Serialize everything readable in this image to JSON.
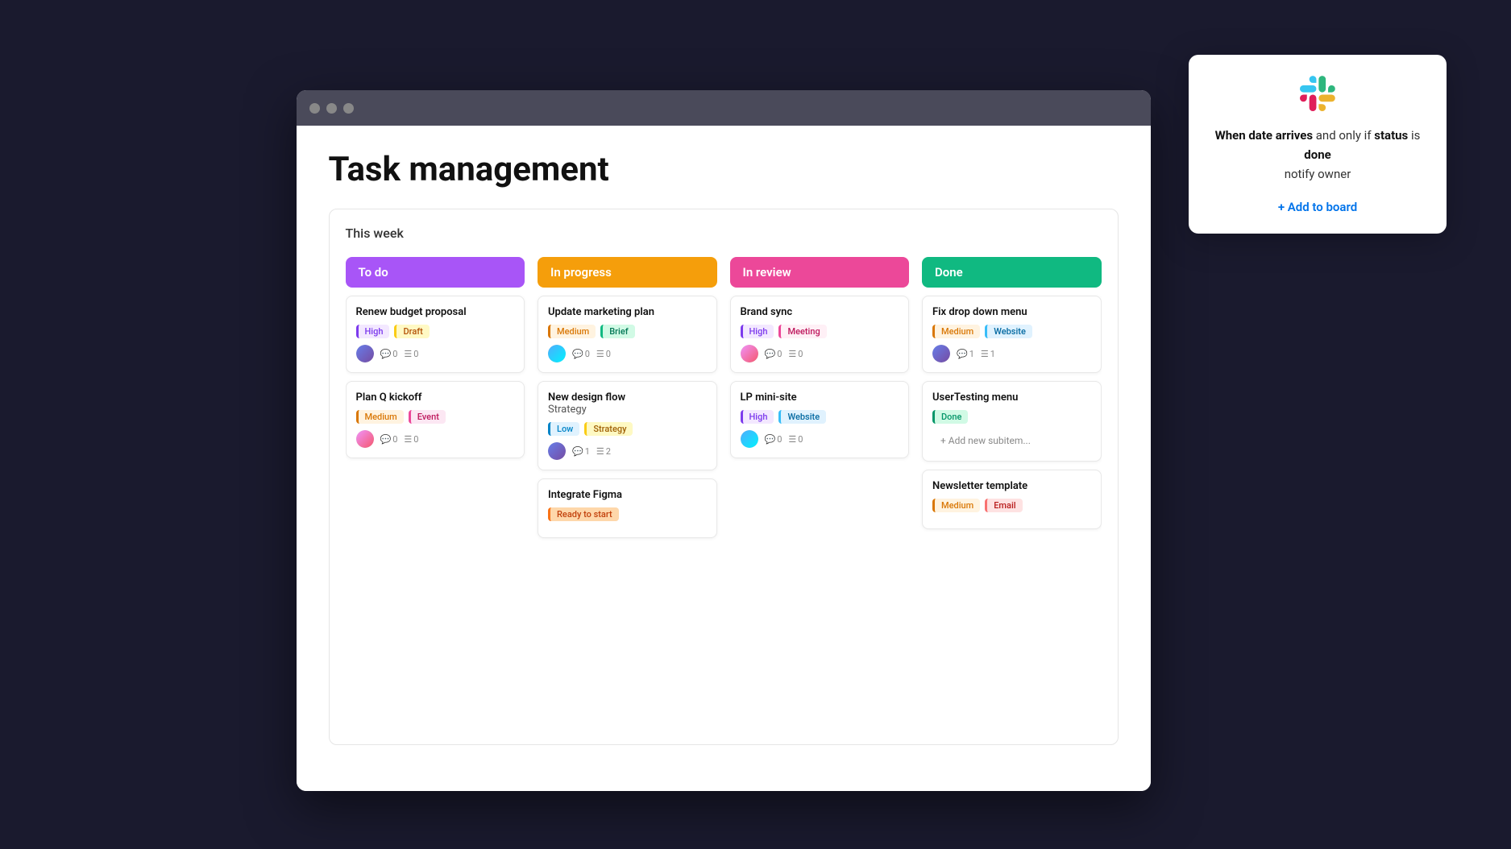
{
  "page": {
    "title": "Task management",
    "section": "This  week"
  },
  "browser": {
    "dots": [
      "dot1",
      "dot2",
      "dot3"
    ]
  },
  "columns": [
    {
      "id": "todo",
      "label": "To do",
      "color_class": "col-todo",
      "cards": [
        {
          "title": "Renew budget proposal",
          "tags": [
            {
              "label": "High",
              "class": "tag-high"
            },
            {
              "label": "Draft",
              "class": "tag-draft"
            }
          ],
          "avatar_class": "avatar-img",
          "comments": "0",
          "subtasks": "0"
        },
        {
          "title": "Plan Q kickoff",
          "tags": [
            {
              "label": "Medium",
              "class": "tag-medium"
            },
            {
              "label": "Event",
              "class": "tag-event"
            }
          ],
          "avatar_class": "avatar-img2",
          "comments": "0",
          "subtasks": "0"
        }
      ]
    },
    {
      "id": "inprogress",
      "label": "In progress",
      "color_class": "col-inprogress",
      "cards": [
        {
          "title": "Update marketing plan",
          "tags": [
            {
              "label": "Medium",
              "class": "tag-medium"
            },
            {
              "label": "Brief",
              "class": "tag-brief"
            }
          ],
          "avatar_class": "avatar-img3",
          "comments": "0",
          "subtasks": "0"
        },
        {
          "title": "New design flow",
          "subtitle": "Strategy",
          "tags": [
            {
              "label": "Low",
              "class": "tag-low"
            },
            {
              "label": "Strategy",
              "class": "tag-strategy"
            }
          ],
          "avatar_class": "avatar-img",
          "comments": "1",
          "subtasks": "2"
        },
        {
          "title": "Integrate Figma",
          "tags": [
            {
              "label": "Ready to start",
              "class": "tag-ready"
            }
          ],
          "avatar_class": null,
          "comments": "0",
          "subtasks": "0"
        }
      ]
    },
    {
      "id": "inreview",
      "label": "In review",
      "color_class": "col-inreview",
      "cards": [
        {
          "title": "Brand sync",
          "tags": [
            {
              "label": "High",
              "class": "tag-high"
            },
            {
              "label": "Meeting",
              "class": "tag-meeting"
            }
          ],
          "avatar_class": "avatar-img2",
          "comments": "0",
          "subtasks": "0"
        },
        {
          "title": "LP mini-site",
          "tags": [
            {
              "label": "High",
              "class": "tag-high"
            },
            {
              "label": "Website",
              "class": "tag-website"
            }
          ],
          "avatar_class": "avatar-img3",
          "comments": "0",
          "subtasks": "0"
        }
      ]
    },
    {
      "id": "done",
      "label": "Done",
      "color_class": "col-done",
      "cards": [
        {
          "title": "Fix drop down menu",
          "tags": [
            {
              "label": "Medium",
              "class": "tag-medium"
            },
            {
              "label": "Website",
              "class": "tag-website"
            }
          ],
          "avatar_class": "avatar-img",
          "comments": "1",
          "subtasks": "1"
        },
        {
          "title": "UserTesting menu",
          "tags": [
            {
              "label": "Done",
              "class": "tag-done"
            }
          ],
          "subitem": "+ Add new subitem...",
          "avatar_class": null,
          "comments": "0",
          "subtasks": "0"
        },
        {
          "title": "Newsletter template",
          "tags": [
            {
              "label": "Medium",
              "class": "tag-medium"
            },
            {
              "label": "Email",
              "class": "tag-email"
            }
          ],
          "avatar_class": null,
          "comments": "0",
          "subtasks": "0"
        }
      ]
    }
  ],
  "popup": {
    "text_part1": "When date arrives",
    "text_part2": "and only if",
    "text_part3": "status",
    "text_part4": "is",
    "text_part5": "done",
    "text_part6": "notify owner",
    "cta": "+ Add to board"
  }
}
